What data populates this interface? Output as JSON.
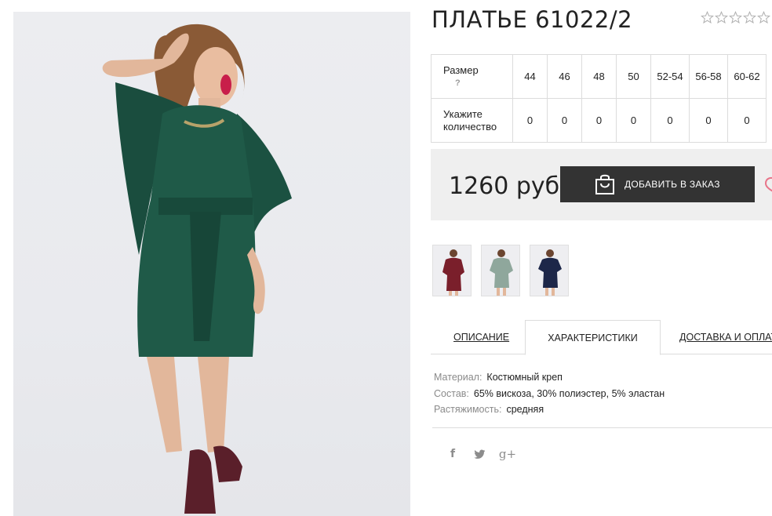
{
  "product": {
    "title": "ПЛАТЬЕ 61022/2",
    "rating": {
      "value": 0,
      "max": 5
    },
    "photo": {
      "description": "main-product-photo"
    }
  },
  "sizes": {
    "row_label": "Размер",
    "help": "?",
    "qty_label": "Укажите количество",
    "items": [
      {
        "size": "44",
        "qty": "0"
      },
      {
        "size": "46",
        "qty": "0"
      },
      {
        "size": "48",
        "qty": "0"
      },
      {
        "size": "50",
        "qty": "0"
      },
      {
        "size": "52-54",
        "qty": "0"
      },
      {
        "size": "56-58",
        "qty": "0"
      },
      {
        "size": "60-62",
        "qty": "0"
      }
    ]
  },
  "order": {
    "price": "1260 руб",
    "add_label": "ДОБАВИТЬ В ЗАКАЗ"
  },
  "thumbnails": [
    {
      "name": "thumb-burgundy",
      "color": "#7a1f2b"
    },
    {
      "name": "thumb-mint",
      "color": "#8fa79c"
    },
    {
      "name": "thumb-navy",
      "color": "#1d2749"
    }
  ],
  "tabs": [
    {
      "label": "ОПИСАНИЕ",
      "active": false
    },
    {
      "label": "ХАРАКТЕРИСТИКИ",
      "active": true
    },
    {
      "label": "ДОСТАВКА И ОПЛАТА",
      "active": false
    }
  ],
  "characteristics": [
    {
      "label": "Материал:",
      "value": "Костюмный креп"
    },
    {
      "label": "Состав:",
      "value": "65% вискоза, 30% полиэстер, 5% эластан"
    },
    {
      "label": "Растяжимость:",
      "value": "средняя"
    }
  ],
  "social": {
    "facebook": "f",
    "google": "g+"
  },
  "colors": {
    "dress": "#1f5a48",
    "button": "#333333",
    "price_bar": "#efefef",
    "heart": "#e8758a"
  }
}
